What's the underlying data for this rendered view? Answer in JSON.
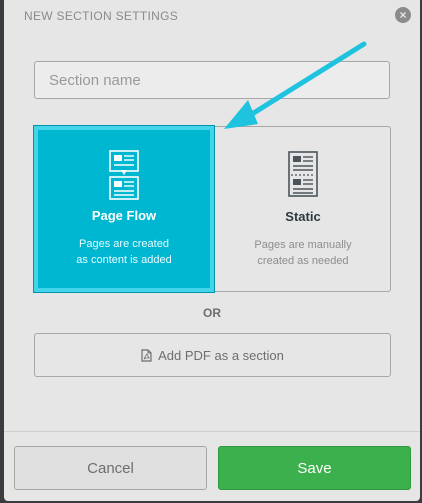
{
  "dialog": {
    "title": "NEW SECTION SETTINGS",
    "close_icon": "close-circle-icon"
  },
  "section_name": {
    "placeholder": "Section name",
    "value": ""
  },
  "options": {
    "page_flow": {
      "title": "Page Flow",
      "desc_line1": "Pages are created",
      "desc_line2": "as content is added",
      "icon": "page-flow-icon",
      "selected": true,
      "color": "#00b7d2"
    },
    "static": {
      "title": "Static",
      "desc_line1": "Pages are manually",
      "desc_line2": "created as needed",
      "icon": "static-page-icon",
      "selected": false
    }
  },
  "or_label": "OR",
  "pdf_button": {
    "label": "Add PDF as a section",
    "icon": "pdf-file-icon"
  },
  "footer": {
    "cancel_label": "Cancel",
    "save_label": "Save",
    "save_color": "#3cb04c"
  },
  "annotation": {
    "arrow_color": "#1fc3e0",
    "icon": "arrow-annotation-icon"
  }
}
